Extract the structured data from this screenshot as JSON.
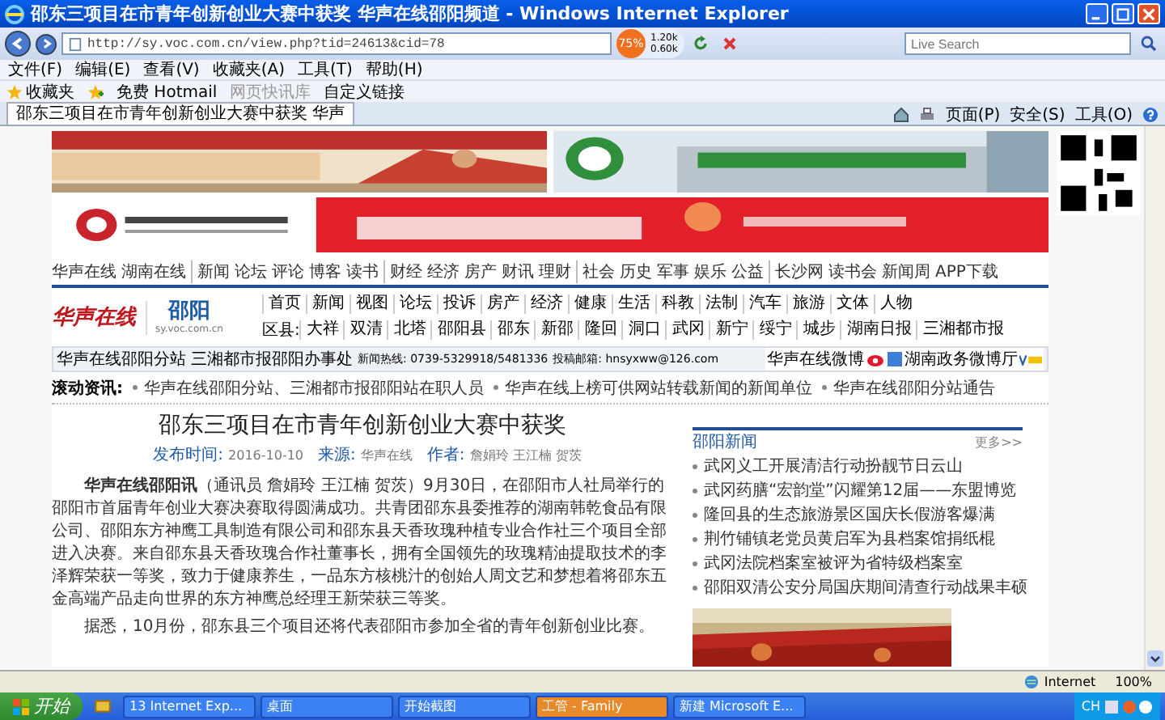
{
  "window": {
    "title": "邵东三项目在市青年创新创业大赛中获奖 华声在线邵阳频道 - Windows Internet Explorer"
  },
  "address_bar": {
    "url": "http://sy.voc.com.cn/view.php?tid=24613&cid=78"
  },
  "network_meter": {
    "percent": "75%",
    "upload": "1.20k",
    "download": "0.60k"
  },
  "search": {
    "placeholder": "Live Search"
  },
  "menu": [
    "文件(F)",
    "编辑(E)",
    "查看(V)",
    "收藏夹(A)",
    "工具(T)",
    "帮助(H)"
  ],
  "favorites_bar": {
    "label": "收藏夹",
    "items": [
      {
        "label": "免费 Hotmail",
        "disabled": false
      },
      {
        "label": "网页快讯库",
        "disabled": true
      },
      {
        "label": "自定义链接",
        "disabled": false
      }
    ]
  },
  "tabs": [
    {
      "label": "邵东三项目在市青年创新创业大赛中获奖 华声",
      "selected": true
    }
  ],
  "command_bar": [
    "页面(P)",
    "安全(S)",
    "工具(O)"
  ],
  "page": {
    "top_nav": [
      [
        "华声在线",
        "湖南在线"
      ],
      [
        "新闻",
        "论坛",
        "评论",
        "博客",
        "读书"
      ],
      [
        "财经",
        "经济",
        "房产",
        "财讯",
        "理财"
      ],
      [
        "社会",
        "历史",
        "军事",
        "娱乐",
        "公益"
      ],
      [
        "长沙网",
        "读书会",
        "新闻周",
        "APP下载"
      ]
    ],
    "site": {
      "logo": "华声在线",
      "channel": "邵阳",
      "domain": "sy.voc.com.cn"
    },
    "channel_nav": [
      "首页",
      "新闻",
      "视图",
      "论坛",
      "投诉",
      "房产",
      "经济",
      "健康",
      "生活",
      "科教",
      "法制",
      "汽车",
      "旅游",
      "文体",
      "人物"
    ],
    "county_nav": {
      "label": "区县:",
      "items": [
        "大祥",
        "双清",
        "北塔",
        "邵阳县",
        "邵东",
        "新邵",
        "隆回",
        "洞口",
        "武冈",
        "新宁",
        "绥宁",
        "城步",
        "湖南日报",
        "三湘都市报"
      ]
    },
    "info_bar": {
      "items": [
        "华声在线邵阳分站",
        "三湘都市报邵阳办事处",
        "新闻热线: 0739-5329918/5481336",
        "投稿邮箱: hnsyxww@126.com"
      ],
      "weibo": "华声在线微博",
      "gov_weibo": "湖南政务微博厅"
    },
    "scroll_news": {
      "label": "滚动资讯:",
      "items": [
        "华声在线邵阳分站、三湘都市报邵阳站在职人员",
        "华声在线上榜可供网站转载新闻的新闻单位",
        "华声在线邵阳分站通告"
      ]
    },
    "article": {
      "title": "邵东三项目在市青年创新创业大赛中获奖",
      "meta": [
        {
          "label": "发布时间:",
          "value": "2016-10-10"
        },
        {
          "label": "来源:",
          "value": "华声在线"
        },
        {
          "label": "作者:",
          "value": "詹娟玲 王江楠 贺茨"
        }
      ],
      "paragraphs": [
        "**华声在线邵阳讯**（通讯员 詹娟玲 王江楠 贺茨）9月30日，在邵阳市人社局举行的邵阳市首届青年创业大赛决赛取得圆满成功。共青团邵东县委推荐的湖南韩乾食品有限公司、邵阳东方神鹰工具制造有限公司和邵东县天香玫瑰种植专业合作社三个项目全部进入决赛。来自邵东县天香玫瑰合作社董事长，拥有全国领先的玫瑰精油提取技术的李泽辉荣获一等奖，致力于健康养生，一品东方核桃汁的创始人周文艺和梦想着将邵东五金高端产品走向世界的东方神鹰总经理王新荣获三等奖。",
        "据悉，10月份，邵东县三个项目还将代表邵阳市参加全省的青年创新创业比赛。"
      ]
    },
    "sidebar": {
      "title": "邵阳新闻",
      "more": "更多>>",
      "items": [
        "武冈义工开展清洁行动扮靓节日云山",
        "武冈药膳“宏韵堂”闪耀第12届——东盟博览",
        "隆回县的生态旅游景区国庆长假游客爆满",
        "荆竹铺镇老党员黄启军为县档案馆捐纸棍",
        "武冈法院档案室被评为省特级档案室",
        "邵阳双清公安分局国庆期间清查行动战果丰硕"
      ]
    }
  },
  "status_bar": {
    "zone": "Internet",
    "zoom": "100%"
  },
  "taskbar": {
    "start": "开始",
    "tasks": [
      {
        "label": "13 Internet Exp...",
        "selected": false
      },
      {
        "label": "桌面",
        "selected": false
      },
      {
        "label": "开始截图",
        "selected": false
      },
      {
        "label": "工管 - Family",
        "selected": true
      },
      {
        "label": "新建 Microsoft E...",
        "selected": false
      }
    ],
    "ime": "CH"
  }
}
